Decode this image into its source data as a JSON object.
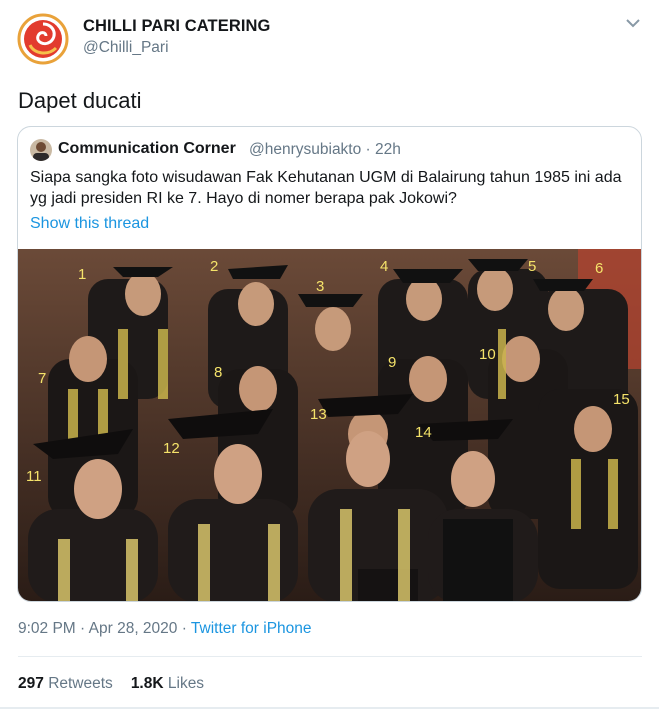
{
  "author": {
    "name": "CHILLI PARI CATERING",
    "handle": "@Chilli_Pari"
  },
  "tweet": {
    "text": "Dapet ducati"
  },
  "quoted": {
    "name": "Communication Corner",
    "handle_time": "@henrysubiakto · 22h",
    "text": "Siapa sangka foto wisudawan Fak Kehutanan UGM di Balairung tahun 1985 ini ada yg jadi presiden RI ke 7. Hayo di nomer berapa pak Jokowi?",
    "show_thread": "Show this thread",
    "photo_labels": [
      "1",
      "2",
      "3",
      "4",
      "5",
      "6",
      "7",
      "8",
      "9",
      "10",
      "11",
      "12",
      "13",
      "14",
      "15"
    ]
  },
  "meta": {
    "time": "9:02 PM",
    "date": "Apr 28, 2020",
    "separator": " · ",
    "source": "Twitter for iPhone"
  },
  "stats": {
    "retweets_count": "297",
    "retweets_label": "Retweets",
    "likes_count": "1.8K",
    "likes_label": "Likes"
  },
  "colors": {
    "link": "#1b95e0",
    "secondary": "#657786",
    "label_yellow": "#f5e36a"
  },
  "icons": {
    "caret": "chevron-down-icon"
  }
}
